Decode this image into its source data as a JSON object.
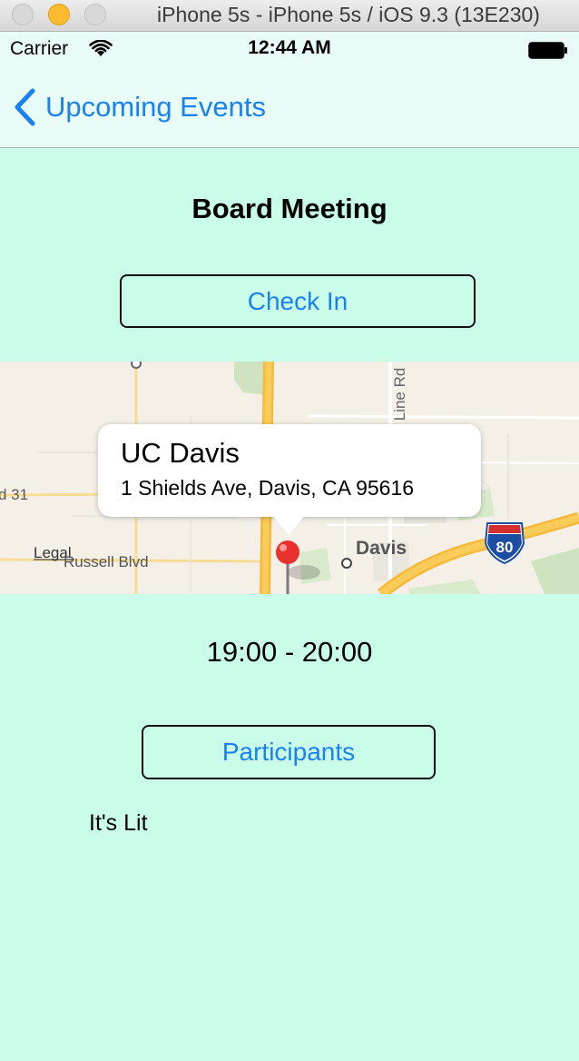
{
  "window": {
    "title": "iPhone 5s - iPhone 5s / iOS 9.3 (13E230)"
  },
  "status_bar": {
    "carrier": "Carrier",
    "time": "12:44 AM"
  },
  "nav": {
    "back_label": "Upcoming Events"
  },
  "event": {
    "title": "Board Meeting",
    "check_in_label": "Check In",
    "time_range": "19:00 - 20:00",
    "participants_label": "Participants",
    "description": "It's Lit"
  },
  "map": {
    "callout_title": "UC Davis",
    "callout_subtitle": "1 Shields Ave, Davis, CA 95616",
    "labels": {
      "road_31": "d 31",
      "legal": "Legal",
      "russell": "Russell Blvd",
      "davis": "Davis",
      "pole_line": "Pole Line Rd",
      "interstate": "80"
    }
  },
  "colors": {
    "background": "#c9fdea",
    "accent": "#1a82f0",
    "pin": "#e8302c"
  }
}
